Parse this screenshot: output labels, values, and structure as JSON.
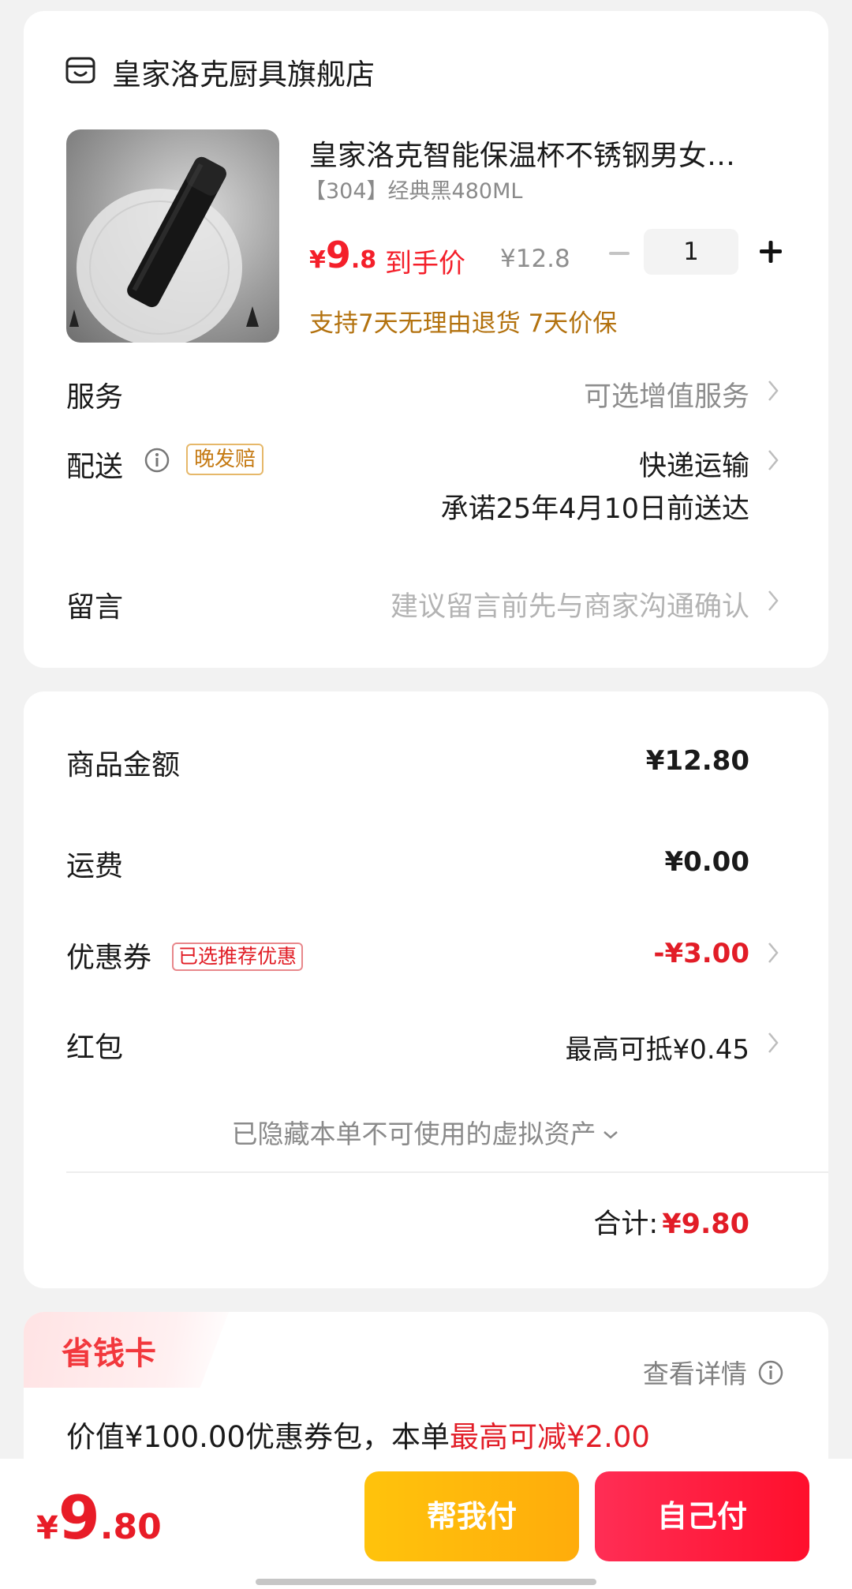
{
  "store": {
    "name": "皇家洛克厨具旗舰店",
    "icon": "store-icon"
  },
  "product": {
    "title": "皇家洛克智能保温杯不锈钢男女…",
    "variant": "【304】经典黑480ML",
    "price_currency": "¥",
    "price_int": "9",
    "price_dec": ".8",
    "price_label": "到手价",
    "original_price": "¥12.8",
    "quantity": "1",
    "guarantee": "支持7天无理由退货 7天价保"
  },
  "service": {
    "label": "服务",
    "value": "可选增值服务"
  },
  "delivery": {
    "label": "配送",
    "tag": "晚发赔",
    "method": "快递运输",
    "promise": "承诺25年4月10日前送达"
  },
  "message": {
    "label": "留言",
    "placeholder": "建议留言前先与商家沟通确认"
  },
  "amounts": {
    "goods_label": "商品金额",
    "goods_value": "¥12.80",
    "shipping_label": "运费",
    "shipping_value": "¥0.00",
    "coupon_label": "优惠券",
    "coupon_tag": "已选推荐优惠",
    "coupon_value": "-¥3.00",
    "redpacket_label": "红包",
    "redpacket_value": "最高可抵¥0.45",
    "hidden_assets": "已隐藏本单不可使用的虚拟资产",
    "total_label": "合计:",
    "total_value": "¥9.80"
  },
  "savings_card": {
    "title": "省钱卡",
    "detail_link": "查看详情",
    "desc_prefix": "价值¥100.00优惠券包，本单",
    "desc_highlight": "最高可减¥2.00"
  },
  "bottom": {
    "currency": "¥",
    "int": "9",
    "dec": ".80",
    "help_pay": "帮我付",
    "self_pay": "自己付"
  },
  "colors": {
    "accent_red": "#f41f2a",
    "guarantee_gold": "#b3720f",
    "help_button": "#ffb80b",
    "self_button": "#ff1d3f"
  }
}
